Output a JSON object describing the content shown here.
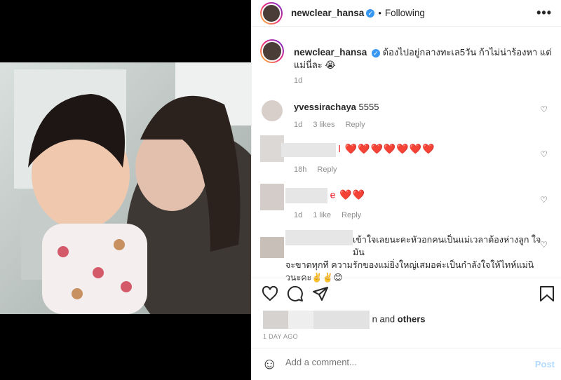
{
  "post": {
    "username": "newclear_hansa",
    "verified_badge": "✓",
    "follow_state": "Following",
    "more_label": "•••",
    "caption_text": "ต้องไปอยู่กลางทะเล5วัน ก้าไม่น่าร้องหา แต่แม่นี่ละ",
    "caption_emoji": "😭",
    "caption_time": "1d"
  },
  "comments": [
    {
      "username": "yvessirachaya",
      "text": "5555",
      "time": "1d",
      "likes": "3 likes",
      "reply": "Reply"
    },
    {
      "username": "",
      "text": "l ❤️❤️❤️❤️❤️❤️❤️",
      "time": "18h",
      "likes": "",
      "reply": "Reply"
    },
    {
      "username": "",
      "text": "e ❤️❤️",
      "time": "1d",
      "likes": "1 like",
      "reply": "Reply"
    },
    {
      "username": "",
      "text_line1": "เข้าใจเลยนะคะหัวอกคนเป็นแม่เวลาต้องห่างลูก ใจมัน",
      "text_line2": "จะขาดทุกที ความรักของแม่ยิ่งใหญ่เสมอค่ะเป็นกำลังใจให้ไทห์แม่นิ",
      "text_line3": "วนะคะ✌️✌️😊"
    }
  ],
  "likes_line": {
    "suffix": "n and",
    "others": "others"
  },
  "time_ago": "1 DAY AGO",
  "add_comment": {
    "emoji_icon": "☺",
    "placeholder": "Add a comment...",
    "post_label": "Post"
  },
  "colors": {
    "accent_blue": "#3897f0",
    "post_disabled": "#b3dbff",
    "heart_red": "#ed1c24",
    "meta_gray": "#8e8e8e"
  }
}
